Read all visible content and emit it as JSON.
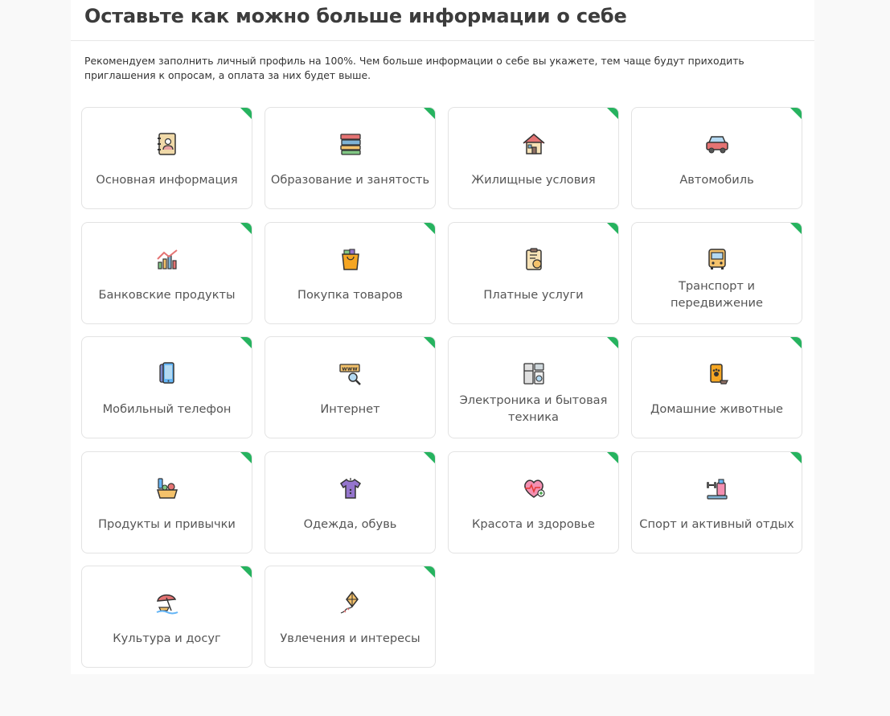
{
  "header": {
    "title": "Оставьте как можно больше информации о себе",
    "intro": "Рекомендуем заполнить личный профиль на 100%. Чем больше информации о себе вы укажете, тем чаще будут приходить приглашения к опросам, а оплата за них будет выше."
  },
  "colors": {
    "accent": "#26b35f",
    "card_border": "#e3e3e3",
    "text": "#555555"
  },
  "categories": [
    {
      "label": "Основная информация",
      "icon": "address-book-icon"
    },
    {
      "label": "Образование и занятость",
      "icon": "books-icon"
    },
    {
      "label": "Жилищные условия",
      "icon": "house-icon"
    },
    {
      "label": "Автомобиль",
      "icon": "car-icon"
    },
    {
      "label": "Банковские продукты",
      "icon": "growth-chart-icon"
    },
    {
      "label": "Покупка товаров",
      "icon": "shopping-bag-icon"
    },
    {
      "label": "Платные услуги",
      "icon": "paid-clipboard-icon"
    },
    {
      "label": "Транспорт и передвижение",
      "icon": "bus-icon"
    },
    {
      "label": "Мобильный телефон",
      "icon": "smartphone-icon"
    },
    {
      "label": "Интернет",
      "icon": "www-search-icon"
    },
    {
      "label": "Электроника и бытовая техника",
      "icon": "appliances-icon"
    },
    {
      "label": "Домашние животные",
      "icon": "pet-food-icon"
    },
    {
      "label": "Продукты и привычки",
      "icon": "groceries-icon"
    },
    {
      "label": "Одежда, обувь",
      "icon": "shirt-icon"
    },
    {
      "label": "Красота и здоровье",
      "icon": "heart-pulse-icon"
    },
    {
      "label": "Спорт и активный отдых",
      "icon": "sports-gear-icon"
    },
    {
      "label": "Культура и досуг",
      "icon": "beach-umbrella-icon"
    },
    {
      "label": "Увлечения и интересы",
      "icon": "kite-icon"
    }
  ]
}
